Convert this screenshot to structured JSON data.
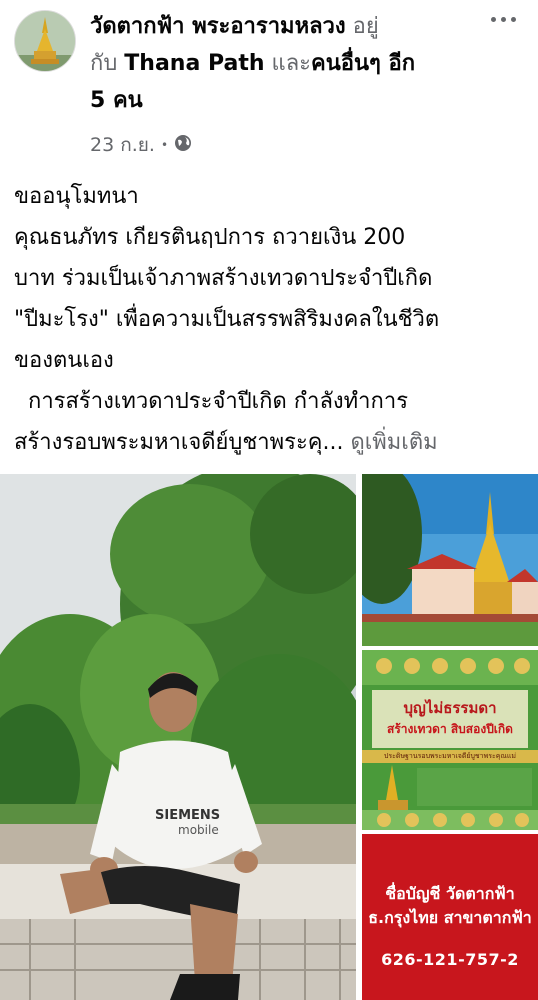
{
  "header": {
    "page_name": "วัดตากฟ้า พระอารามหลวง",
    "with_text_1": " อยู่",
    "with_text_2": "กับ ",
    "tagged_person": "Thana Path",
    "and_text": " และ",
    "others": "คนอื่นๆ อีก",
    "others_count": "5 คน",
    "timestamp": "23 ก.ย.",
    "separator": "•",
    "privacy_icon": "globe-icon",
    "menu_icon": "more-options-icon"
  },
  "post": {
    "line1": "ขออนุโมทนา",
    "line2": "คุณธนภัทร เกียรตินฤปการ ถวายเงิน 200",
    "line3": "บาท ร่วมเป็นเจ้าภาพสร้างเทวดาประจำปีเกิด",
    "line4": "\"ปีมะโรง\" เพื่อความเป็นสรรพสิริมงคลในชีวิต",
    "line5": "ของตนเอง",
    "line6": "  การสร้างเทวดาประจำปีเกิด กำลังทำการ",
    "line7": "สร้างรอบพระมหาเจดีย์บูชาพระคุ...",
    "see_more": "ดูเพิ่มเติม"
  },
  "poster": {
    "headline": "บุญไม่ธรรมดา",
    "subheadline": "สร้างเทวดา สิบสองปีเกิด",
    "banner": "ประดิษฐานรอบพระมหาเจดีย์บูชาพระคุณแม่"
  },
  "account_card": {
    "account_name": "ชื่อบัญชี วัดตากฟ้า",
    "bank": "ธ.กรุงไทย สาขาตากฟ้า",
    "account_number": "626-121-757-2"
  },
  "colors": {
    "text": "#050505",
    "secondary": "#65676b",
    "account_bg": "#c8161d"
  }
}
